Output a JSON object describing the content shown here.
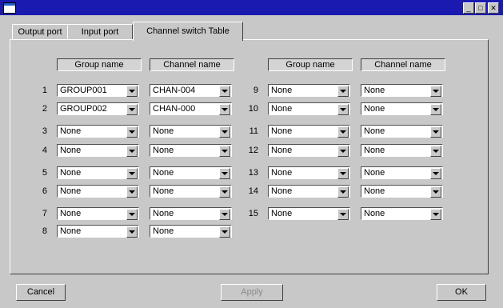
{
  "window": {
    "minimize_glyph": "_",
    "maximize_glyph": "□",
    "close_glyph": "✕"
  },
  "tabs": [
    {
      "label": "Output port",
      "active": false
    },
    {
      "label": "Input port",
      "active": false
    },
    {
      "label": "Channel switch Table",
      "active": true
    }
  ],
  "table": {
    "group_header": "Group name",
    "channel_header": "Channel name",
    "left_rows": [
      {
        "num": "1",
        "group": "GROUP001",
        "channel": "CHAN-004"
      },
      {
        "num": "2",
        "group": "GROUP002",
        "channel": "CHAN-000"
      },
      {
        "num": "3",
        "group": "None",
        "channel": "None"
      },
      {
        "num": "4",
        "group": "None",
        "channel": "None"
      },
      {
        "num": "5",
        "group": "None",
        "channel": "None"
      },
      {
        "num": "6",
        "group": "None",
        "channel": "None"
      },
      {
        "num": "7",
        "group": "None",
        "channel": "None"
      },
      {
        "num": "8",
        "group": "None",
        "channel": "None"
      }
    ],
    "right_rows": [
      {
        "num": "9",
        "group": "None",
        "channel": "None"
      },
      {
        "num": "10",
        "group": "None",
        "channel": "None"
      },
      {
        "num": "11",
        "group": "None",
        "channel": "None"
      },
      {
        "num": "12",
        "group": "None",
        "channel": "None"
      },
      {
        "num": "13",
        "group": "None",
        "channel": "None"
      },
      {
        "num": "14",
        "group": "None",
        "channel": "None"
      },
      {
        "num": "15",
        "group": "None",
        "channel": "None"
      }
    ]
  },
  "buttons": {
    "cancel": "Cancel",
    "apply": "Apply",
    "ok": "OK"
  }
}
